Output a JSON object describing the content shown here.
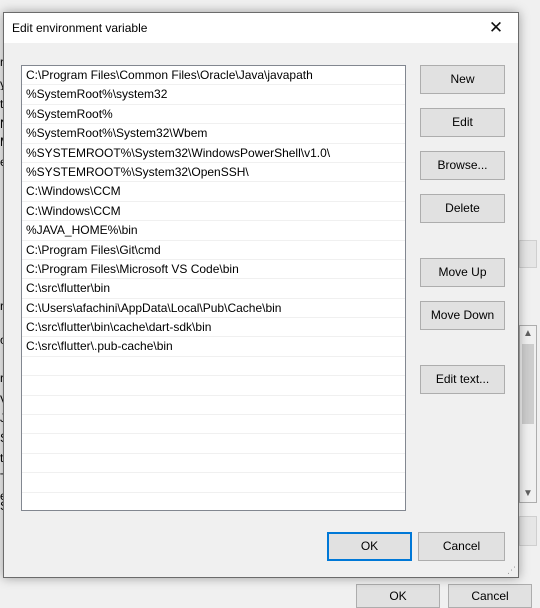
{
  "dialog": {
    "title": "Edit environment variable",
    "close_label": "✕",
    "paths": [
      "C:\\Program Files\\Common Files\\Oracle\\Java\\javapath",
      "%SystemRoot%\\system32",
      "%SystemRoot%",
      "%SystemRoot%\\System32\\Wbem",
      "%SYSTEMROOT%\\System32\\WindowsPowerShell\\v1.0\\",
      "%SYSTEMROOT%\\System32\\OpenSSH\\",
      "C:\\Windows\\CCM",
      "C:\\Windows\\CCM",
      "%JAVA_HOME%\\bin",
      "C:\\Program Files\\Git\\cmd",
      "C:\\Program Files\\Microsoft VS Code\\bin",
      "C:\\src\\flutter\\bin",
      "C:\\Users\\afachini\\AppData\\Local\\Pub\\Cache\\bin",
      "C:\\src\\flutter\\bin\\cache\\dart-sdk\\bin",
      "C:\\src\\flutter\\.pub-cache\\bin"
    ],
    "buttons": {
      "new": "New",
      "edit": "Edit",
      "browse": "Browse...",
      "delete": "Delete",
      "move_up": "Move Up",
      "move_down": "Move Down",
      "edit_text": "Edit text...",
      "ok": "OK",
      "cancel": "Cancel"
    }
  },
  "background": {
    "edge_letters": [
      "r",
      "y",
      "t",
      "N",
      "M",
      "e",
      "r",
      "o",
      "r",
      "V",
      "J",
      "S",
      "t",
      "T",
      "e",
      "S"
    ],
    "ok_label": "OK",
    "cancel_label": "Cancel",
    "colors": {
      "accent": "#0078d7",
      "list_border": "#828790",
      "button_face": "#e1e1e1"
    }
  }
}
